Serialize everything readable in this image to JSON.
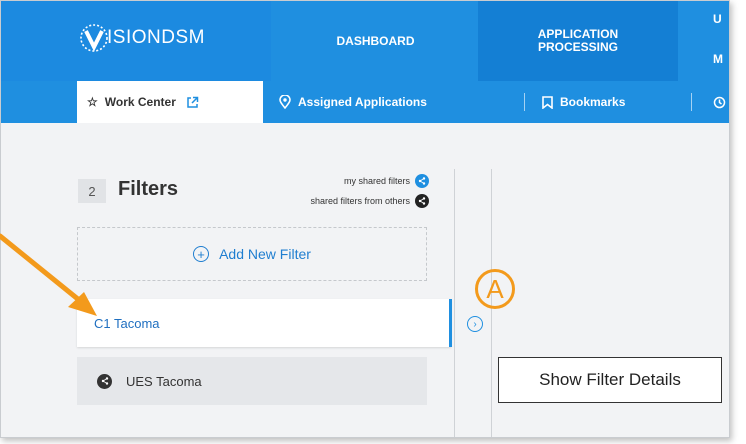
{
  "brand": {
    "logo_text_bold": "ISION",
    "logo_text_light": "DSM"
  },
  "nav": {
    "dashboard": "DASHBOARD",
    "application_processing_line1": "APPLICATION",
    "application_processing_line2": "PROCESSING",
    "more_line1": "U",
    "more_line2": "M"
  },
  "subnav": {
    "work_center": "Work Center",
    "assigned_applications": "Assigned Applications",
    "bookmarks": "Bookmarks"
  },
  "filters": {
    "count": "2",
    "title": "Filters",
    "my_shared": "my shared filters",
    "shared_from_others": "shared filters from others",
    "add_new": "Add New Filter",
    "items": [
      {
        "label": "C1 Tacoma",
        "selected": true
      },
      {
        "label": "UES Tacoma",
        "selected": false
      }
    ]
  },
  "annotation": {
    "marker": "A",
    "tooltip": "Show Filter Details"
  },
  "colors": {
    "primary": "#1f8fe0",
    "accent": "#f39a1c",
    "link": "#1f7ed0"
  }
}
